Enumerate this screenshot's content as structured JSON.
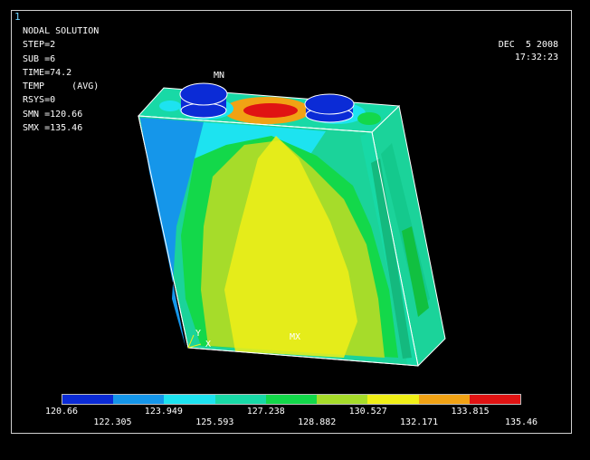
{
  "window": {
    "number": "1"
  },
  "plot_info": {
    "title": "NODAL SOLUTION",
    "step": "STEP=2",
    "sub": "SUB =6",
    "time": "TIME=74.2",
    "temp": "TEMP     (AVG)",
    "rsys": "RSYS=0",
    "smn": "SMN =120.66",
    "smx": "SMX =135.46"
  },
  "timestamp": {
    "date": "DEC  5 2008",
    "time": "17:32:23"
  },
  "markers": {
    "min": "MN",
    "max": "MX"
  },
  "axes": {
    "y": "Y",
    "x": "X"
  },
  "legend": {
    "colors": [
      "#0b2bd6",
      "#1596ea",
      "#1de3f0",
      "#18d9a6",
      "#13d84a",
      "#a6dc2a",
      "#f0ef17",
      "#f1a214",
      "#e01313"
    ],
    "values": [
      "120.66",
      "122.305",
      "123.949",
      "125.593",
      "127.238",
      "128.882",
      "130.527",
      "132.171",
      "133.815",
      "135.46"
    ]
  }
}
